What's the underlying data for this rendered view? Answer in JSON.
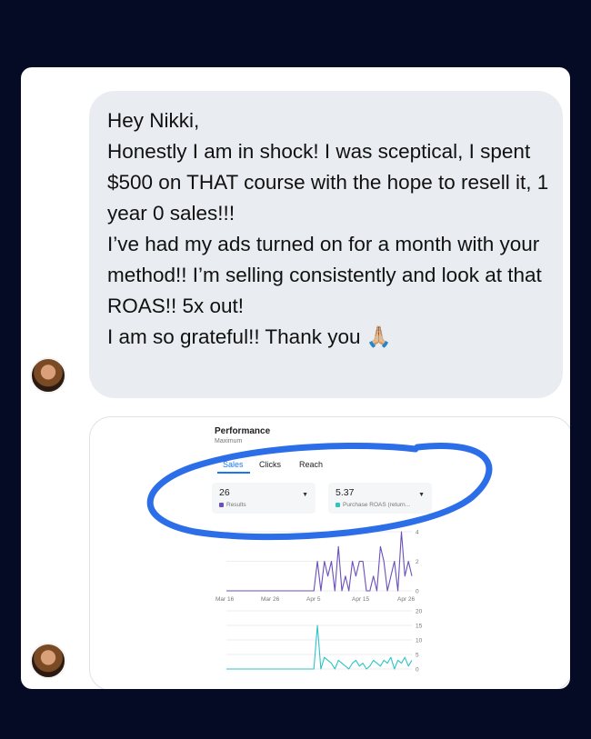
{
  "message": {
    "lines": [
      "Hey Nikki,",
      "Honestly I am in shock! I was sceptical, I spent $500 on THAT course with the hope to resell it, 1 year 0 sales!!!",
      "I’ve had my ads turned on for a month with your method!! I’m selling consistently and look at that ROAS!! 5x out!",
      "I am so grateful!! Thank you"
    ],
    "emoji": "🙏🏼"
  },
  "screenshot": {
    "title": "Performance",
    "subtitle": "Maximum",
    "tabs": [
      "Sales",
      "Clicks",
      "Reach"
    ],
    "metrics": [
      {
        "value": "26",
        "label": "Results",
        "color": "#6b4fbb"
      },
      {
        "value": "5.37",
        "label": "Purchase ROAS (return...",
        "color": "#2ec4c4"
      }
    ]
  },
  "chart_data": [
    {
      "type": "line",
      "title": "",
      "x_ticks": [
        "Mar 16",
        "Mar 26",
        "Apr 5",
        "Apr 15",
        "Apr 26"
      ],
      "y_ticks": [
        0,
        2,
        4
      ],
      "ylim": [
        0,
        4
      ],
      "series": [
        {
          "color": "#6b4fbb",
          "values": [
            0,
            0,
            0,
            0,
            0,
            0,
            0,
            0,
            0,
            0,
            0,
            0,
            0,
            0,
            0,
            0,
            0,
            0,
            0,
            0,
            0,
            0,
            0,
            0,
            0,
            0,
            2,
            0,
            2,
            1,
            2,
            0,
            3,
            0,
            1,
            0,
            2,
            1,
            2,
            2,
            0,
            0,
            1,
            0,
            3,
            2,
            0,
            1,
            2,
            0,
            4,
            1,
            2,
            1
          ]
        }
      ]
    },
    {
      "type": "line",
      "title": "",
      "y_ticks": [
        0,
        5,
        10,
        15,
        20
      ],
      "ylim": [
        0,
        20
      ],
      "series": [
        {
          "color": "#2ec4c4",
          "values": [
            0,
            0,
            0,
            0,
            0,
            0,
            0,
            0,
            0,
            0,
            0,
            0,
            0,
            0,
            0,
            0,
            0,
            0,
            0,
            0,
            0,
            0,
            0,
            0,
            0,
            0,
            15,
            0,
            4,
            3,
            2,
            0,
            3,
            2,
            1,
            0,
            2,
            3,
            1,
            2,
            0,
            1,
            3,
            2,
            1,
            3,
            2,
            4,
            0,
            3,
            2,
            4,
            1,
            3
          ]
        }
      ]
    }
  ]
}
